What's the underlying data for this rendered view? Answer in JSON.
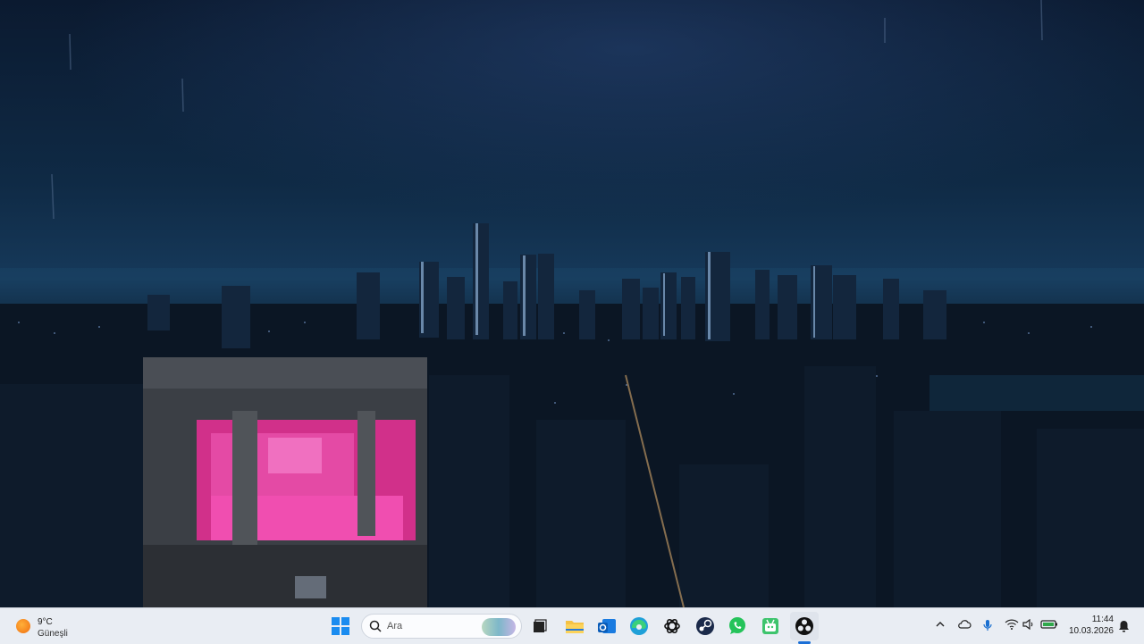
{
  "wallpaper": {
    "description_label": ""
  },
  "weather": {
    "temperature": "9°C",
    "condition": "Güneşli",
    "icon": "sun-icon"
  },
  "search": {
    "placeholder": "Ara"
  },
  "taskbar_apps": [
    {
      "name": "start",
      "icon": "windows-icon"
    },
    {
      "name": "task-view",
      "icon": "task-view-icon"
    },
    {
      "name": "file-explorer",
      "icon": "folder-icon"
    },
    {
      "name": "outlook",
      "icon": "mail-icon"
    },
    {
      "name": "edge",
      "icon": "edge-icon"
    },
    {
      "name": "chatgpt",
      "icon": "chatgpt-icon"
    },
    {
      "name": "steam",
      "icon": "steam-icon"
    },
    {
      "name": "whatsapp",
      "icon": "whatsapp-icon"
    },
    {
      "name": "android-studio",
      "icon": "android-icon"
    },
    {
      "name": "obs",
      "icon": "obs-icon",
      "active": true
    }
  ],
  "tray": {
    "icons": [
      "chevron-up-icon",
      "cloud-icon",
      "microphone-icon",
      "wifi-icon",
      "speaker-icon",
      "battery-icon"
    ]
  },
  "clock": {
    "time": "11:44",
    "date": "10.03.2026"
  },
  "colors": {
    "taskbar": "#e9edf3",
    "accent": "#1b6fd6",
    "neon": "#e8389a"
  }
}
